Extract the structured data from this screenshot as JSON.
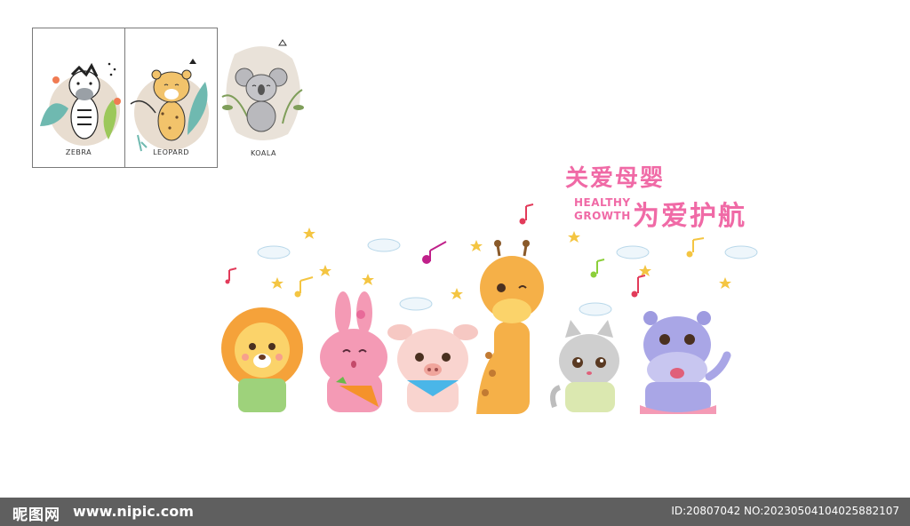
{
  "posters": [
    {
      "caption": "ZEBRA",
      "animal": "zebra"
    },
    {
      "caption": "LEOPARD",
      "animal": "leopard"
    },
    {
      "caption": "KOALA",
      "animal": "koala"
    }
  ],
  "headline": {
    "line1_cn": "关爱母婴",
    "line2_en": "HEALTHY",
    "line3_en": "GROWTH",
    "line2_cn": "为爱护航"
  },
  "animals": [
    "lion",
    "rabbit",
    "pig",
    "giraffe",
    "cat",
    "hippo"
  ],
  "colors": {
    "pink": "#f06aa6",
    "footer": "#5f5f5f",
    "lion": "#f5a23a",
    "rabbit": "#f49ab5",
    "pig": "#f6c8c3",
    "giraffe": "#f5b048",
    "cat": "#c9c9c9",
    "hippo": "#9e9be0"
  },
  "footer": {
    "logo": "昵图网",
    "url": "www.nipic.com",
    "id_text": "ID:20807042 NO:20230504104025882107"
  }
}
